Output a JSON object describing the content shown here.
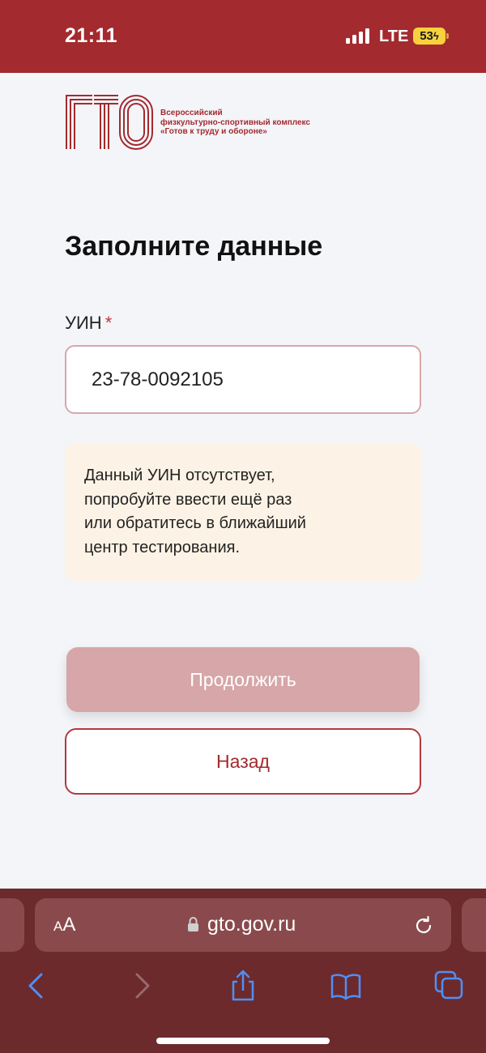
{
  "status_bar": {
    "time": "21:11",
    "network": "LTE",
    "battery": "53"
  },
  "logo": {
    "letters": "ГТО",
    "caption_lines": [
      "Всероссийский",
      "физкультурно-спортивный комплекс",
      "«Готов к труду и обороне»"
    ]
  },
  "form": {
    "title": "Заполните данные",
    "uin_label": "УИН",
    "required_mark": "*",
    "uin_value": "23-78-0092105"
  },
  "notice": {
    "lines": [
      "Данный УИН отсутствует,",
      "попробуйте ввести ещё раз",
      "или обратитесь в ближайший",
      "центр тестирования."
    ]
  },
  "buttons": {
    "continue": "Продолжить",
    "back": "Назад"
  },
  "browser": {
    "text_size": "AA",
    "url": "gto.gov.ru",
    "icons": [
      "back-icon",
      "forward-icon",
      "share-icon",
      "bookmarks-icon",
      "tabs-icon"
    ]
  },
  "colors": {
    "brand": "#a32a2e",
    "browser_bar": "#6c2a2d",
    "notice_bg": "#fcf3e6",
    "disabled_button": "#d6a6a8"
  }
}
